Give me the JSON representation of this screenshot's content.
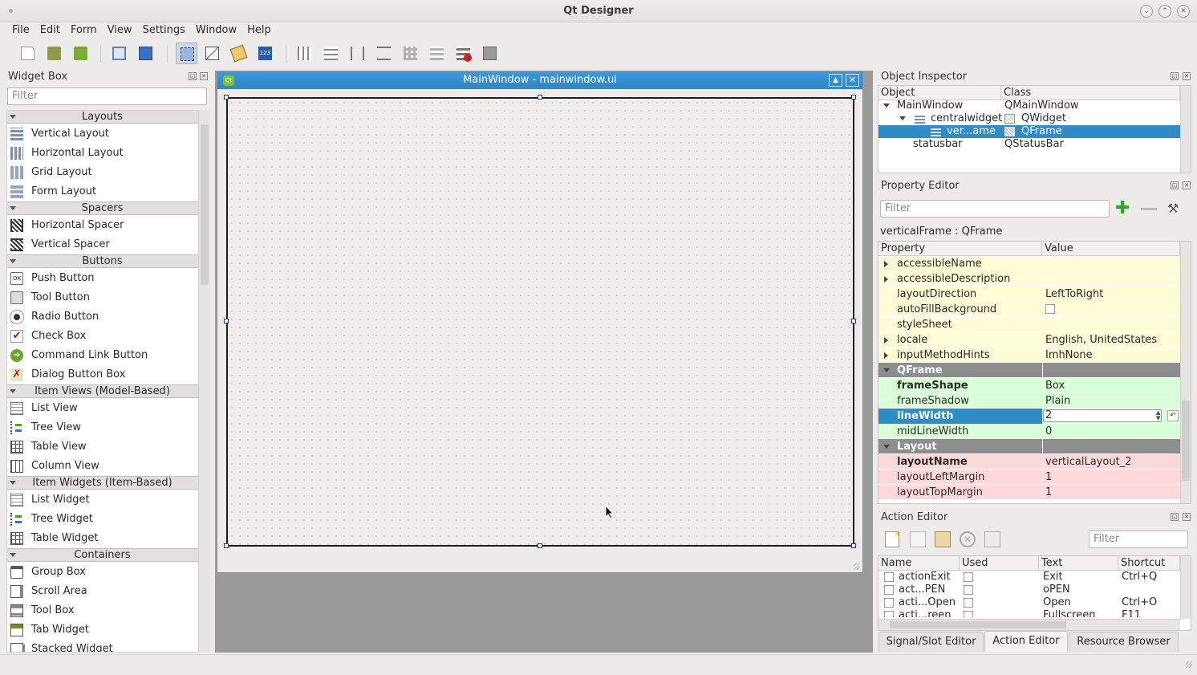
{
  "window": {
    "title": "Qt Designer"
  },
  "menu": [
    "File",
    "Edit",
    "Form",
    "View",
    "Settings",
    "Window",
    "Help"
  ],
  "widget_box": {
    "title": "Widget Box",
    "filter_placeholder": "Filter",
    "categories": [
      {
        "name": "Layouts",
        "items": [
          "Vertical Layout",
          "Horizontal Layout",
          "Grid Layout",
          "Form Layout"
        ]
      },
      {
        "name": "Spacers",
        "items": [
          "Horizontal Spacer",
          "Vertical Spacer"
        ]
      },
      {
        "name": "Buttons",
        "items": [
          "Push Button",
          "Tool Button",
          "Radio Button",
          "Check Box",
          "Command Link Button",
          "Dialog Button Box"
        ]
      },
      {
        "name": "Item Views (Model-Based)",
        "items": [
          "List View",
          "Tree View",
          "Table View",
          "Column View"
        ]
      },
      {
        "name": "Item Widgets (Item-Based)",
        "items": [
          "List Widget",
          "Tree Widget",
          "Table Widget"
        ]
      },
      {
        "name": "Containers",
        "items": [
          "Group Box",
          "Scroll Area",
          "Tool Box",
          "Tab Widget",
          "Stacked Widget"
        ]
      }
    ]
  },
  "form_window": {
    "title": "MainWindow - mainwindow.ui"
  },
  "object_inspector": {
    "title": "Object Inspector",
    "col_object": "Object",
    "col_class": "Class",
    "rows": [
      {
        "object": "MainWindow",
        "class": "QMainWindow"
      },
      {
        "object": "centralwidget",
        "class": "QWidget"
      },
      {
        "object": "ver...ame",
        "class": "QFrame"
      },
      {
        "object": "statusbar",
        "class": "QStatusBar"
      }
    ]
  },
  "property_editor": {
    "title": "Property Editor",
    "filter_placeholder": "Filter",
    "object_label": "verticalFrame : QFrame",
    "col_property": "Property",
    "col_value": "Value",
    "rows": [
      {
        "name": "accessibleName",
        "value": ""
      },
      {
        "name": "accessibleDescription",
        "value": ""
      },
      {
        "name": "layoutDirection",
        "value": "LeftToRight"
      },
      {
        "name": "autoFillBackground",
        "value": ""
      },
      {
        "name": "styleSheet",
        "value": ""
      },
      {
        "name": "locale",
        "value": "English, UnitedStates"
      },
      {
        "name": "inputMethodHints",
        "value": "ImhNone"
      },
      {
        "name": "QFrame",
        "value": ""
      },
      {
        "name": "frameShape",
        "value": "Box"
      },
      {
        "name": "frameShadow",
        "value": "Plain"
      },
      {
        "name": "lineWidth",
        "value": "2"
      },
      {
        "name": "midLineWidth",
        "value": "0"
      },
      {
        "name": "Layout",
        "value": ""
      },
      {
        "name": "layoutName",
        "value": "verticalLayout_2"
      },
      {
        "name": "layoutLeftMargin",
        "value": "1"
      },
      {
        "name": "layoutTopMargin",
        "value": "1"
      }
    ]
  },
  "action_editor": {
    "title": "Action Editor",
    "filter_placeholder": "Filter",
    "columns": [
      "Name",
      "Used",
      "Text",
      "Shortcut"
    ],
    "rows": [
      {
        "name": "actionExit",
        "text": "Exit",
        "shortcut": "Ctrl+Q"
      },
      {
        "name": "act...PEN",
        "text": "oPEN",
        "shortcut": ""
      },
      {
        "name": "acti...Open",
        "text": "Open",
        "shortcut": "Ctrl+O"
      },
      {
        "name": "acti...reen",
        "text": "Fullscreen",
        "shortcut": "F11"
      }
    ]
  },
  "bottom_tabs": [
    "Signal/Slot Editor",
    "Action Editor",
    "Resource Browser"
  ],
  "colors": {
    "selection": "#308cc6",
    "yellow": "#fffcd7",
    "green": "#d9ffd9",
    "red": "#ffd9d9",
    "group": "#8e8e8e"
  }
}
